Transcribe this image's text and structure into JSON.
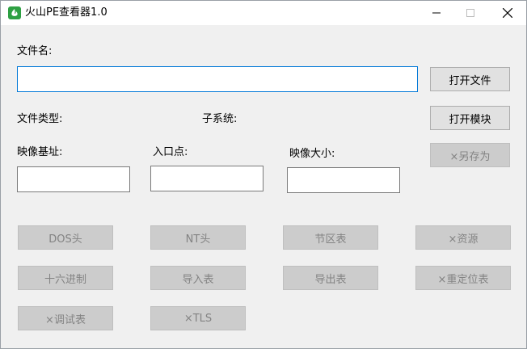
{
  "window": {
    "title": "火山PE查看器1.0",
    "controls": {
      "minimize": "minimize",
      "maximize": "maximize",
      "close": "close"
    }
  },
  "form": {
    "file_name_label": "文件名:",
    "file_name_value": "",
    "file_type_label": "文件类型:",
    "subsystem_label": "子系统:",
    "image_base_label": "映像基址:",
    "image_base_value": "",
    "entry_point_label": "入口点:",
    "entry_point_value": "",
    "image_size_label": "映像大小:",
    "image_size_value": ""
  },
  "actions": {
    "open_file": "打开文件",
    "open_module": "打开模块",
    "save_as": "×另存为"
  },
  "grid": {
    "dos_header": "DOS头",
    "nt_header": "NT头",
    "section_table": "节区表",
    "resources": "×资源",
    "hex": "十六进制",
    "import_table": "导入表",
    "export_table": "导出表",
    "reloc_table": "×重定位表",
    "debug_table": "×调试表",
    "tls": "×TLS"
  },
  "colors": {
    "accent_focus": "#0078d7",
    "window_bg": "#f0f0f0",
    "disabled_button_bg": "#cccccc",
    "disabled_text": "#838383",
    "icon_green": "#2ea043"
  }
}
